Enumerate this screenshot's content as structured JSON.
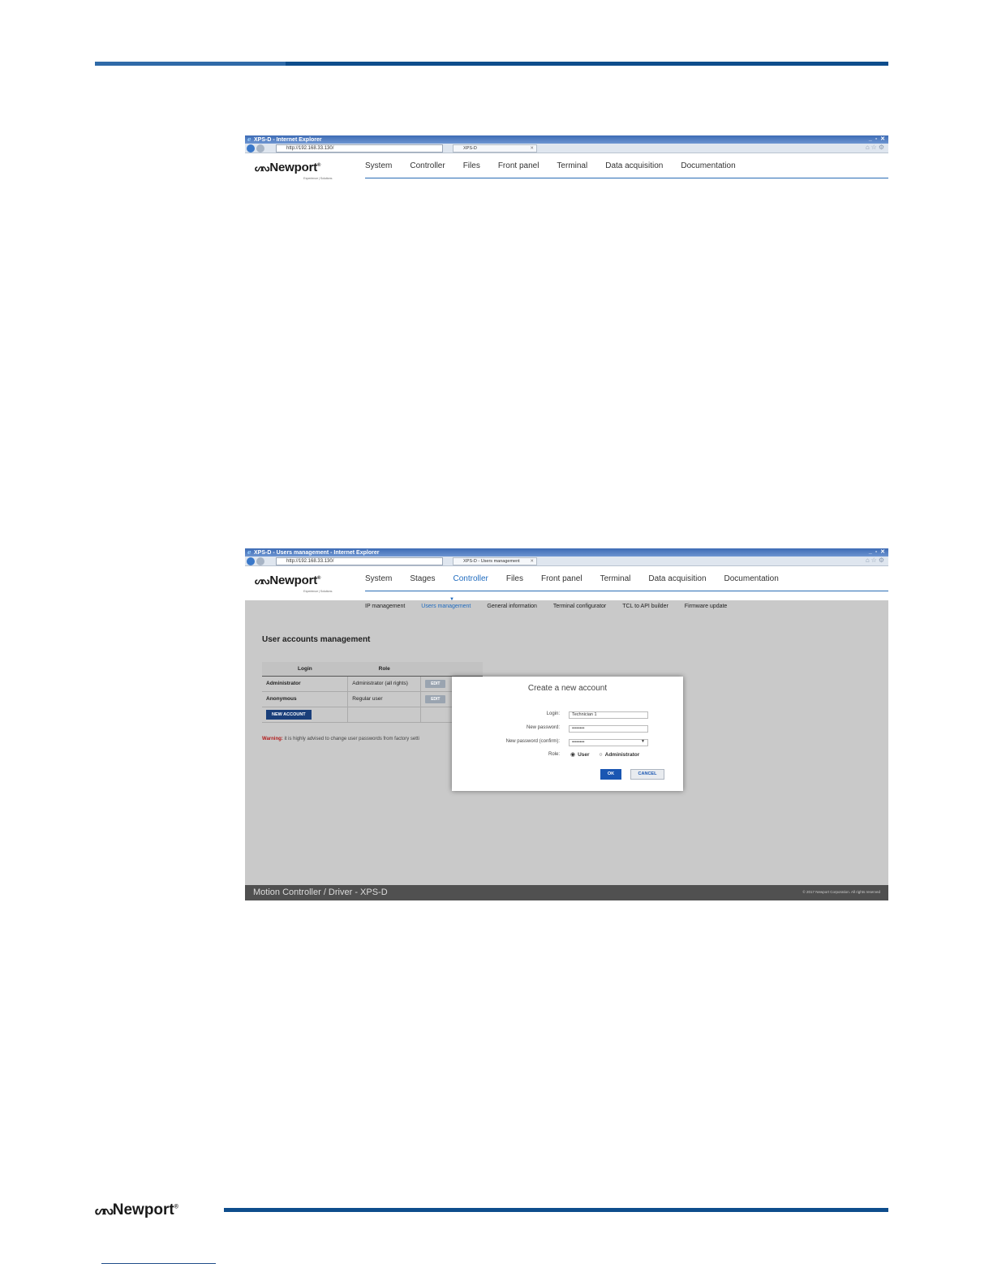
{
  "screenshot1": {
    "window_title": "XPS-D - Internet Explorer",
    "address": "http://192.168.33.130/",
    "tab_label": "XPS-D",
    "logo": {
      "name": "Newport",
      "tagline": "Experience | Solutions"
    },
    "nav": [
      "System",
      "Controller",
      "Files",
      "Front panel",
      "Terminal",
      "Data acquisition",
      "Documentation"
    ]
  },
  "screenshot2": {
    "window_title": "XPS-D - Users management - Internet Explorer",
    "address": "http://192.168.33.130/",
    "tab_label": "XPS-D - Users management",
    "logo": {
      "name": "Newport",
      "tagline": "Experience | Solutions"
    },
    "nav": [
      "System",
      "Stages",
      "Controller",
      "Files",
      "Front panel",
      "Terminal",
      "Data acquisition",
      "Documentation"
    ],
    "active_nav": "Controller",
    "subnav": [
      "IP management",
      "Users management",
      "General information",
      "Terminal configurator",
      "TCL to API builder",
      "Firmware update"
    ],
    "active_subnav": "Users management",
    "page_title": "User accounts management",
    "table": {
      "headers": [
        "Login",
        "Role"
      ],
      "rows": [
        {
          "login": "Administrator",
          "role": "Administrator (all rights)",
          "edit": "EDIT"
        },
        {
          "login": "Anonymous",
          "role": "Regular user",
          "edit": "EDIT"
        }
      ],
      "new_account": "NEW ACCOUNT"
    },
    "warning": {
      "label": "Warning:",
      "text": "it is highly advised to change user passwords from factory setti"
    },
    "modal": {
      "title": "Create a new account",
      "login_label": "Login:",
      "login_value": "Technician 1",
      "password_label": "New password:",
      "password_value": "••••••••",
      "confirm_label": "New password (confirm):",
      "confirm_value": "••••••••",
      "role_label": "Role:",
      "role_options": [
        "User",
        "Administrator"
      ],
      "selected_role": "User",
      "ok": "OK",
      "cancel": "CANCEL"
    },
    "footer": {
      "title": "Motion Controller / Driver - XPS-D",
      "copyright": "© 2017 Newport Corporation. All rights reserved"
    }
  },
  "page_footer": {
    "logo": "Newport"
  },
  "colors": {
    "brand_blue": "#0e4d8c",
    "link_blue": "#1f6bbf",
    "warning_red": "#b21c1c"
  }
}
